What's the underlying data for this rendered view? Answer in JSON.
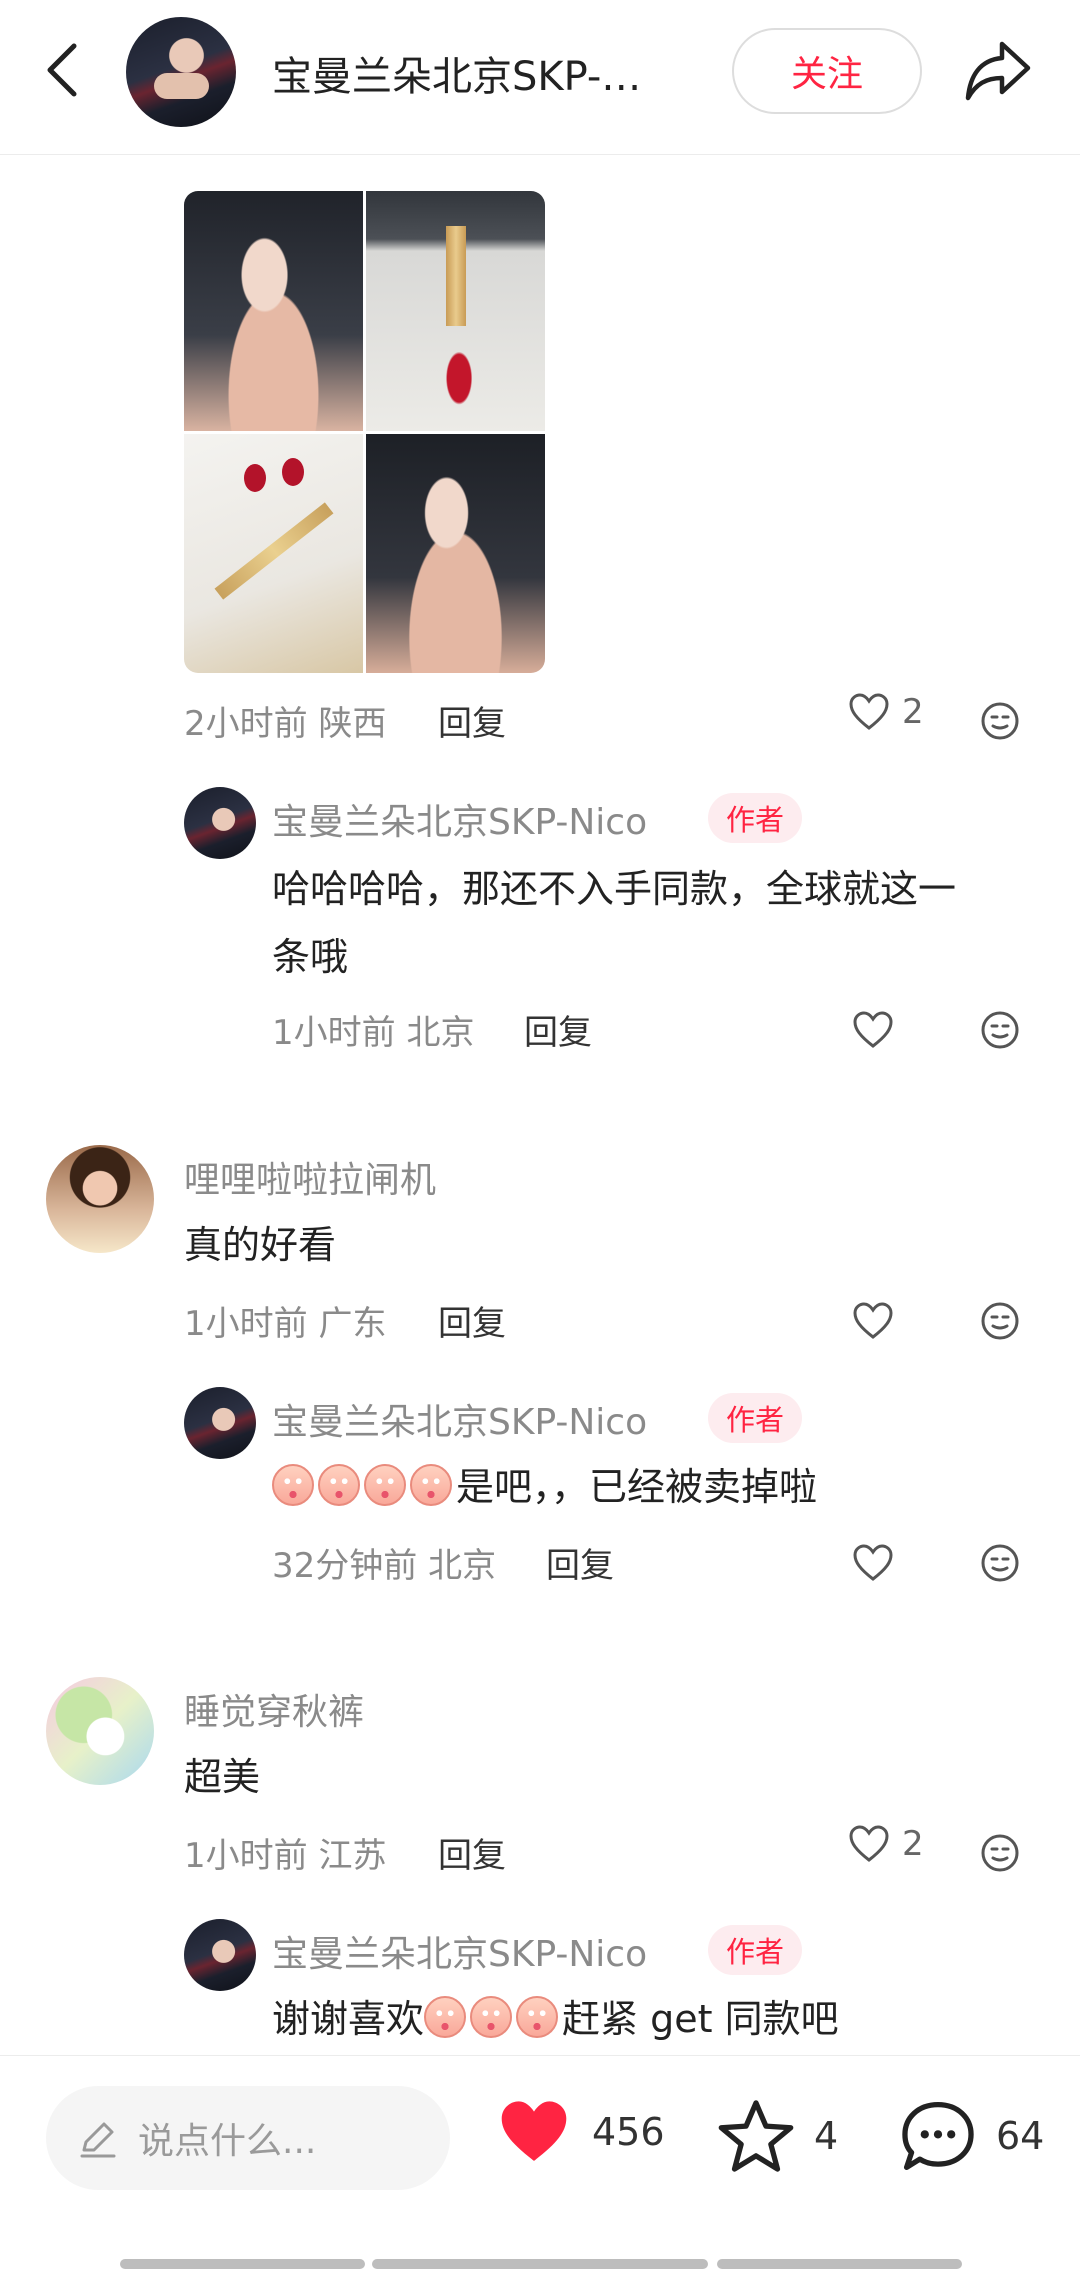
{
  "header": {
    "title": "宝曼兰朵北京SKP-…",
    "follow_label": "关注"
  },
  "comments": [
    {
      "time_location": "2小时前 陕西",
      "reply_label": "回复",
      "like_count": "2",
      "reply": {
        "author": "宝曼兰朵北京SKP-Nico",
        "author_tag": "作者",
        "text_line1": "哈哈哈哈，那还不入手同款，全球就这一",
        "text_line2": "条哦",
        "time_location": "1小时前 北京",
        "reply_label": "回复"
      }
    },
    {
      "user": "哩哩啦啦拉闸机",
      "text": "真的好看",
      "time_location": "1小时前 广东",
      "reply_label": "回复",
      "reply": {
        "author": "宝曼兰朵北京SKP-Nico",
        "author_tag": "作者",
        "text": "是吧，，已经被卖掉啦",
        "time_location": "32分钟前 北京",
        "reply_label": "回复"
      }
    },
    {
      "user": "睡觉穿秋裤",
      "text": "超美",
      "time_location": "1小时前 江苏",
      "reply_label": "回复",
      "like_count": "2",
      "reply": {
        "author": "宝曼兰朵北京SKP-Nico",
        "author_tag": "作者",
        "text_a": "谢谢喜欢",
        "text_b": "赶紧 get 同款吧"
      }
    }
  ],
  "bottom_bar": {
    "input_placeholder": "说点什么...",
    "likes": "456",
    "favorites": "4",
    "comments": "64",
    "like_color": "#ff2442"
  },
  "icons": [
    "back-arrow-icon",
    "share-icon",
    "heart-icon",
    "emoji-icon",
    "pencil-icon",
    "star-icon",
    "comment-bubble-icon"
  ]
}
